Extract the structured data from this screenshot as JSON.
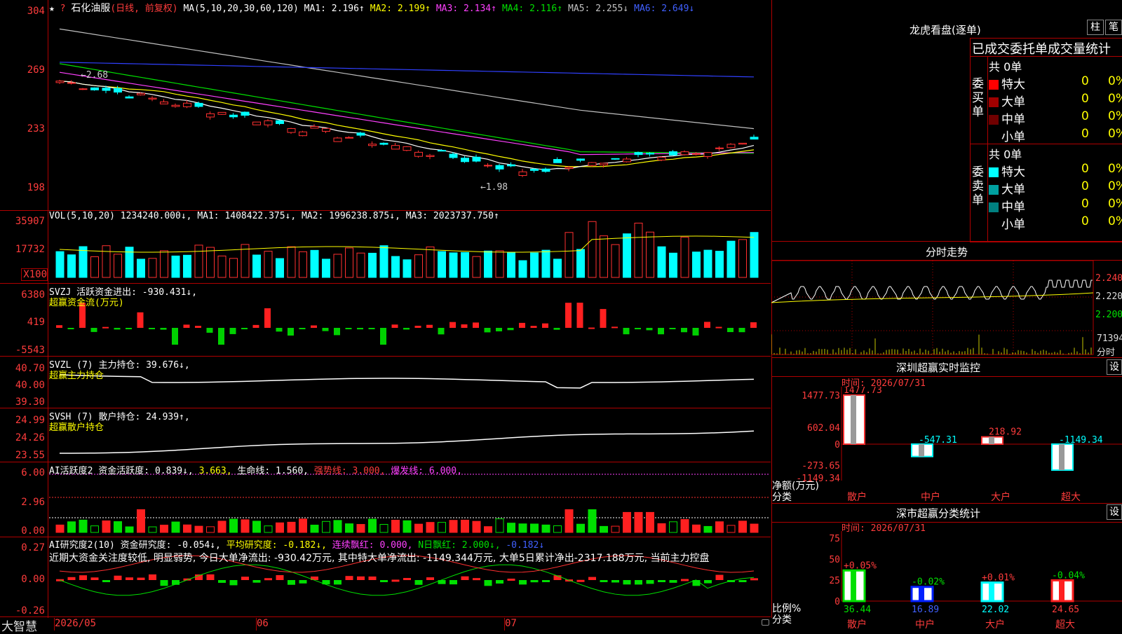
{
  "stock": {
    "name": "石化油服",
    "period": "(日线, 前复权)",
    "star": "★"
  },
  "ma": {
    "label": "MA(5,10,20,30,60,120)",
    "items": [
      {
        "t": "MA1: 2.196↑",
        "c": "#ffffff"
      },
      {
        "t": "MA2: 2.199↑",
        "c": "#ffff00"
      },
      {
        "t": "MA3: 2.134↑",
        "c": "#ff40ff"
      },
      {
        "t": "MA4: 2.116↑",
        "c": "#00e000"
      },
      {
        "t": "MA5: 2.255↓",
        "c": "#c0c0c0"
      },
      {
        "t": "MA6: 2.649↓",
        "c": "#4060ff"
      }
    ]
  },
  "price_axis": [
    "304",
    "269",
    "233",
    "198"
  ],
  "price_notes": {
    "high": "←2.68",
    "low": "←1.98"
  },
  "vol": {
    "title": "VOL(5,10,20) 1234240.000↓, MA1: 1408422.375↓, MA2: 1996238.875↓, MA3: 2023737.750↑",
    "axis": [
      "35907",
      "17732",
      "X100"
    ]
  },
  "svzj": {
    "title": "SVZJ  活跃资金进出: -930.431↓,",
    "sub": "超赢资金流(万元)",
    "axis": [
      "6380",
      "419",
      "-5543"
    ]
  },
  "svzl": {
    "title": "SVZL (7) 主力持仓: 39.676↓,",
    "sub": "超赢主力持仓",
    "axis": [
      "40.70",
      "40.00",
      "39.30"
    ]
  },
  "svsh": {
    "title": "SVSH (7) 散户持仓: 24.939↑,",
    "sub": "超赢散户持仓",
    "axis": [
      "24.99",
      "24.26",
      "23.55"
    ]
  },
  "ai1": {
    "title_a": "AI活跃度2 资金活跃度: 0.839↓,",
    "title_b": " 3.663,",
    "title_c": " 生命线: 1.560,",
    "title_d": " 强势线: 3.000,",
    "title_e": " 爆发线: 6.000,",
    "axis": [
      "6.00",
      "2.96",
      "0.00"
    ]
  },
  "ai2": {
    "title_a": "AI研究度2(10) 资金研究度: -0.054↓,",
    "title_b": " 平均研究度: -0.182↓,",
    "title_c": " 连续飘红: 0.000,",
    "title_d": " N日飘红: 2.000↓,",
    "title_e": " -0.182↓",
    "commentary": "近期大资金关注度较低, 明显弱势, 今日大单净流出: -930.42万元, 其中特大单净流出: -1149.344万元, 大单5日累计净出-2317.188万元, 当前主力控盘",
    "axis": [
      "0.27",
      "0.00",
      "-0.26"
    ]
  },
  "xaxis": {
    "brand": "大智慧",
    "labels": [
      "2026/05",
      "06",
      "07"
    ]
  },
  "dragon": {
    "title": "龙虎看盘(逐单)",
    "btn1": "柱",
    "btn2": "笔",
    "header": "已成交委托单成交量统计",
    "buy": {
      "side": "委买单",
      "total": "共 0单",
      "rows": [
        {
          "l": "特大",
          "v": "0",
          "p": "0%",
          "c": "#ff0000"
        },
        {
          "l": "大单",
          "v": "0",
          "p": "0%",
          "c": "#a00000"
        },
        {
          "l": "中单",
          "v": "0",
          "p": "0%",
          "c": "#700000"
        },
        {
          "l": "小单",
          "v": "0",
          "p": "0%",
          "c": "#000000"
        }
      ]
    },
    "sell": {
      "side": "委卖单",
      "total": "共 0单",
      "rows": [
        {
          "l": "特大",
          "v": "0",
          "p": "0%",
          "c": "#00ffff"
        },
        {
          "l": "大单",
          "v": "0",
          "p": "0%",
          "c": "#00a0a0"
        },
        {
          "l": "中单",
          "v": "0",
          "p": "0%",
          "c": "#008080"
        },
        {
          "l": "小单",
          "v": "0",
          "p": "0%",
          "c": "#000000"
        }
      ]
    }
  },
  "intraday": {
    "title": "分时走势",
    "prices": [
      "2.240",
      "2.220",
      "2.200"
    ],
    "vol": "71394",
    "vol_unit": "分时"
  },
  "monitor": {
    "title": "深圳超赢实时监控",
    "btn": "设",
    "time": "时间: 2026/07/31",
    "axis": [
      "1477.73",
      "602.04",
      "0",
      "-273.65",
      "-1149.34"
    ],
    "ylabel": "净额(万元)",
    "xlabel": "分类",
    "chart_data": {
      "type": "bar",
      "categories": [
        "散户",
        "中户",
        "大户",
        "超大"
      ],
      "values": [
        1477.73,
        -547.31,
        218.92,
        -1149.34
      ],
      "labels": [
        "1477.73",
        "-547.31",
        "218.92",
        "-1149.34"
      ],
      "ylim": [
        -1149.34,
        1477.73
      ]
    }
  },
  "stats": {
    "title": "深市超赢分类统计",
    "btn": "设",
    "time": "时间: 2026/07/31",
    "axis": [
      "75",
      "50",
      "25",
      "0"
    ],
    "ylabel": "比例%",
    "xlabel": "分类",
    "chart_data": {
      "type": "bar",
      "categories": [
        "散户",
        "中户",
        "大户",
        "超大"
      ],
      "values": [
        36.44,
        16.89,
        22.02,
        24.65
      ],
      "changes": [
        "+0.05%",
        "-0.02%",
        "+0.01%",
        "-0.04%"
      ],
      "ylim": [
        0,
        75
      ]
    }
  }
}
